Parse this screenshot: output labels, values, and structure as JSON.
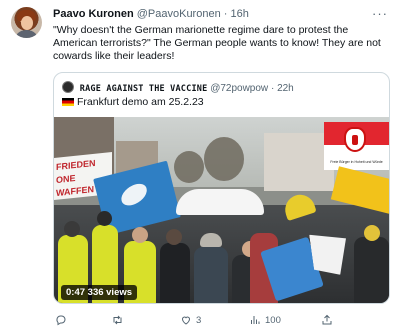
{
  "tweet": {
    "author_name": "Paavo Kuronen",
    "author_handle": "@PaavoKuronen",
    "separator": "·",
    "time": "16h",
    "more_icon": "more-icon",
    "text": "\"Why doesn't the German marionette regime dare to protest the American terrorists?\" The German people wants to know! They are not cowards like their leaders!"
  },
  "quote": {
    "author_name": "RAGE AGAINST THE VACCINE",
    "author_handle": "@72powpow",
    "separator": "·",
    "time": "22h",
    "text": "Frankfurt demo am 25.2.23",
    "flag_icon": "germany-flag-icon",
    "media": {
      "duration": "0:47",
      "views": "336 views",
      "banner_text_line1": "FRIEDEN",
      "banner_text_line2": "ONE",
      "banner_text_line3": "WAFFEN",
      "flag_caption": "Freie Bürger in Hoheit und Würde"
    }
  },
  "actions": {
    "reply": {
      "icon": "reply-icon",
      "count": ""
    },
    "retweet": {
      "icon": "retweet-icon",
      "count": ""
    },
    "like": {
      "icon": "heart-icon",
      "count": "3"
    },
    "views": {
      "icon": "analytics-icon",
      "count": "100"
    },
    "share": {
      "icon": "share-icon",
      "count": ""
    }
  },
  "colors": {
    "text_primary": "#0f1419",
    "text_secondary": "#536471",
    "border": "#cfd9de"
  }
}
